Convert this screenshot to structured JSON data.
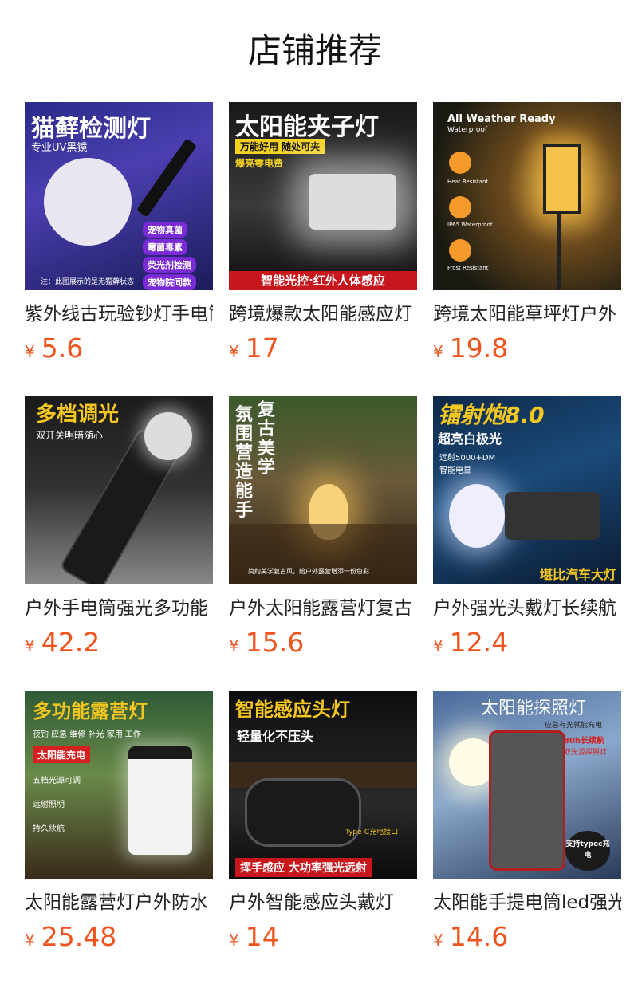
{
  "header": {
    "title": "店铺推荐"
  },
  "currency_symbol": "¥",
  "products": [
    {
      "name": "紫外线古玩验钞灯手电筒",
      "price": "5.6",
      "thumb": {
        "headline": "猫藓检测灯",
        "sub": "专业UV黑镜",
        "tags": [
          "宠物真菌",
          "霉菌毒素",
          "荧光剂检测",
          "宠物院同款"
        ],
        "note": "注：此图展示的是无猫藓状态"
      }
    },
    {
      "name": "跨境爆款太阳能感应灯",
      "price": "17",
      "thumb": {
        "headline": "太阳能夹子灯",
        "sub": "万能好用 随处可夹",
        "tags": [
          "爆亮零电费"
        ],
        "note": "智能光控·红外人体感应"
      }
    },
    {
      "name": "跨境太阳能草坪灯户外",
      "price": "19.8",
      "thumb": {
        "headline": "All Weather Ready",
        "sub": "Waterproof",
        "tags": [
          "Heat Resistant",
          "IP65 Waterproof",
          "Frost Resistant"
        ],
        "note": ""
      }
    },
    {
      "name": "户外手电筒强光多功能",
      "price": "42.2",
      "thumb": {
        "headline": "多档调光",
        "sub": "双开关明暗随心",
        "tags": [],
        "note": ""
      }
    },
    {
      "name": "户外太阳能露营灯复古",
      "price": "15.6",
      "thumb": {
        "headline": "复古美学",
        "sub": "氛围营造能手",
        "tags": [],
        "note": "简约美学复古风，给户外露营增添一份色彩"
      }
    },
    {
      "name": "户外强光头戴灯长续航",
      "price": "12.4",
      "thumb": {
        "headline": "镭射炮8.0",
        "sub": "超亮白极光",
        "tags": [
          "远射5000+DM",
          "智能电显"
        ],
        "note": "堪比汽车大灯"
      }
    },
    {
      "name": "太阳能露营灯户外防水",
      "price": "25.48",
      "thumb": {
        "headline": "多功能露营灯",
        "sub": "夜钓 应急 维修 补光 家用 工作",
        "tags": [
          "太阳能充电",
          "五档光源可调",
          "远射照明",
          "持久续航"
        ],
        "note": ""
      }
    },
    {
      "name": "户外智能感应头戴灯",
      "price": "14",
      "thumb": {
        "headline": "智能感应头灯",
        "sub": "轻量化不压头",
        "tags": [
          "Type-C充电接口"
        ],
        "note": "挥手感应 大功率强光远射"
      }
    },
    {
      "name": "太阳能手提电筒led强光",
      "price": "14.6",
      "thumb": {
        "headline": "太阳能探照灯",
        "sub": "应急有光就能充电",
        "tags": [
          "30h长续航",
          "双光源探照灯",
          "支持typec充电"
        ],
        "note": ""
      }
    }
  ]
}
